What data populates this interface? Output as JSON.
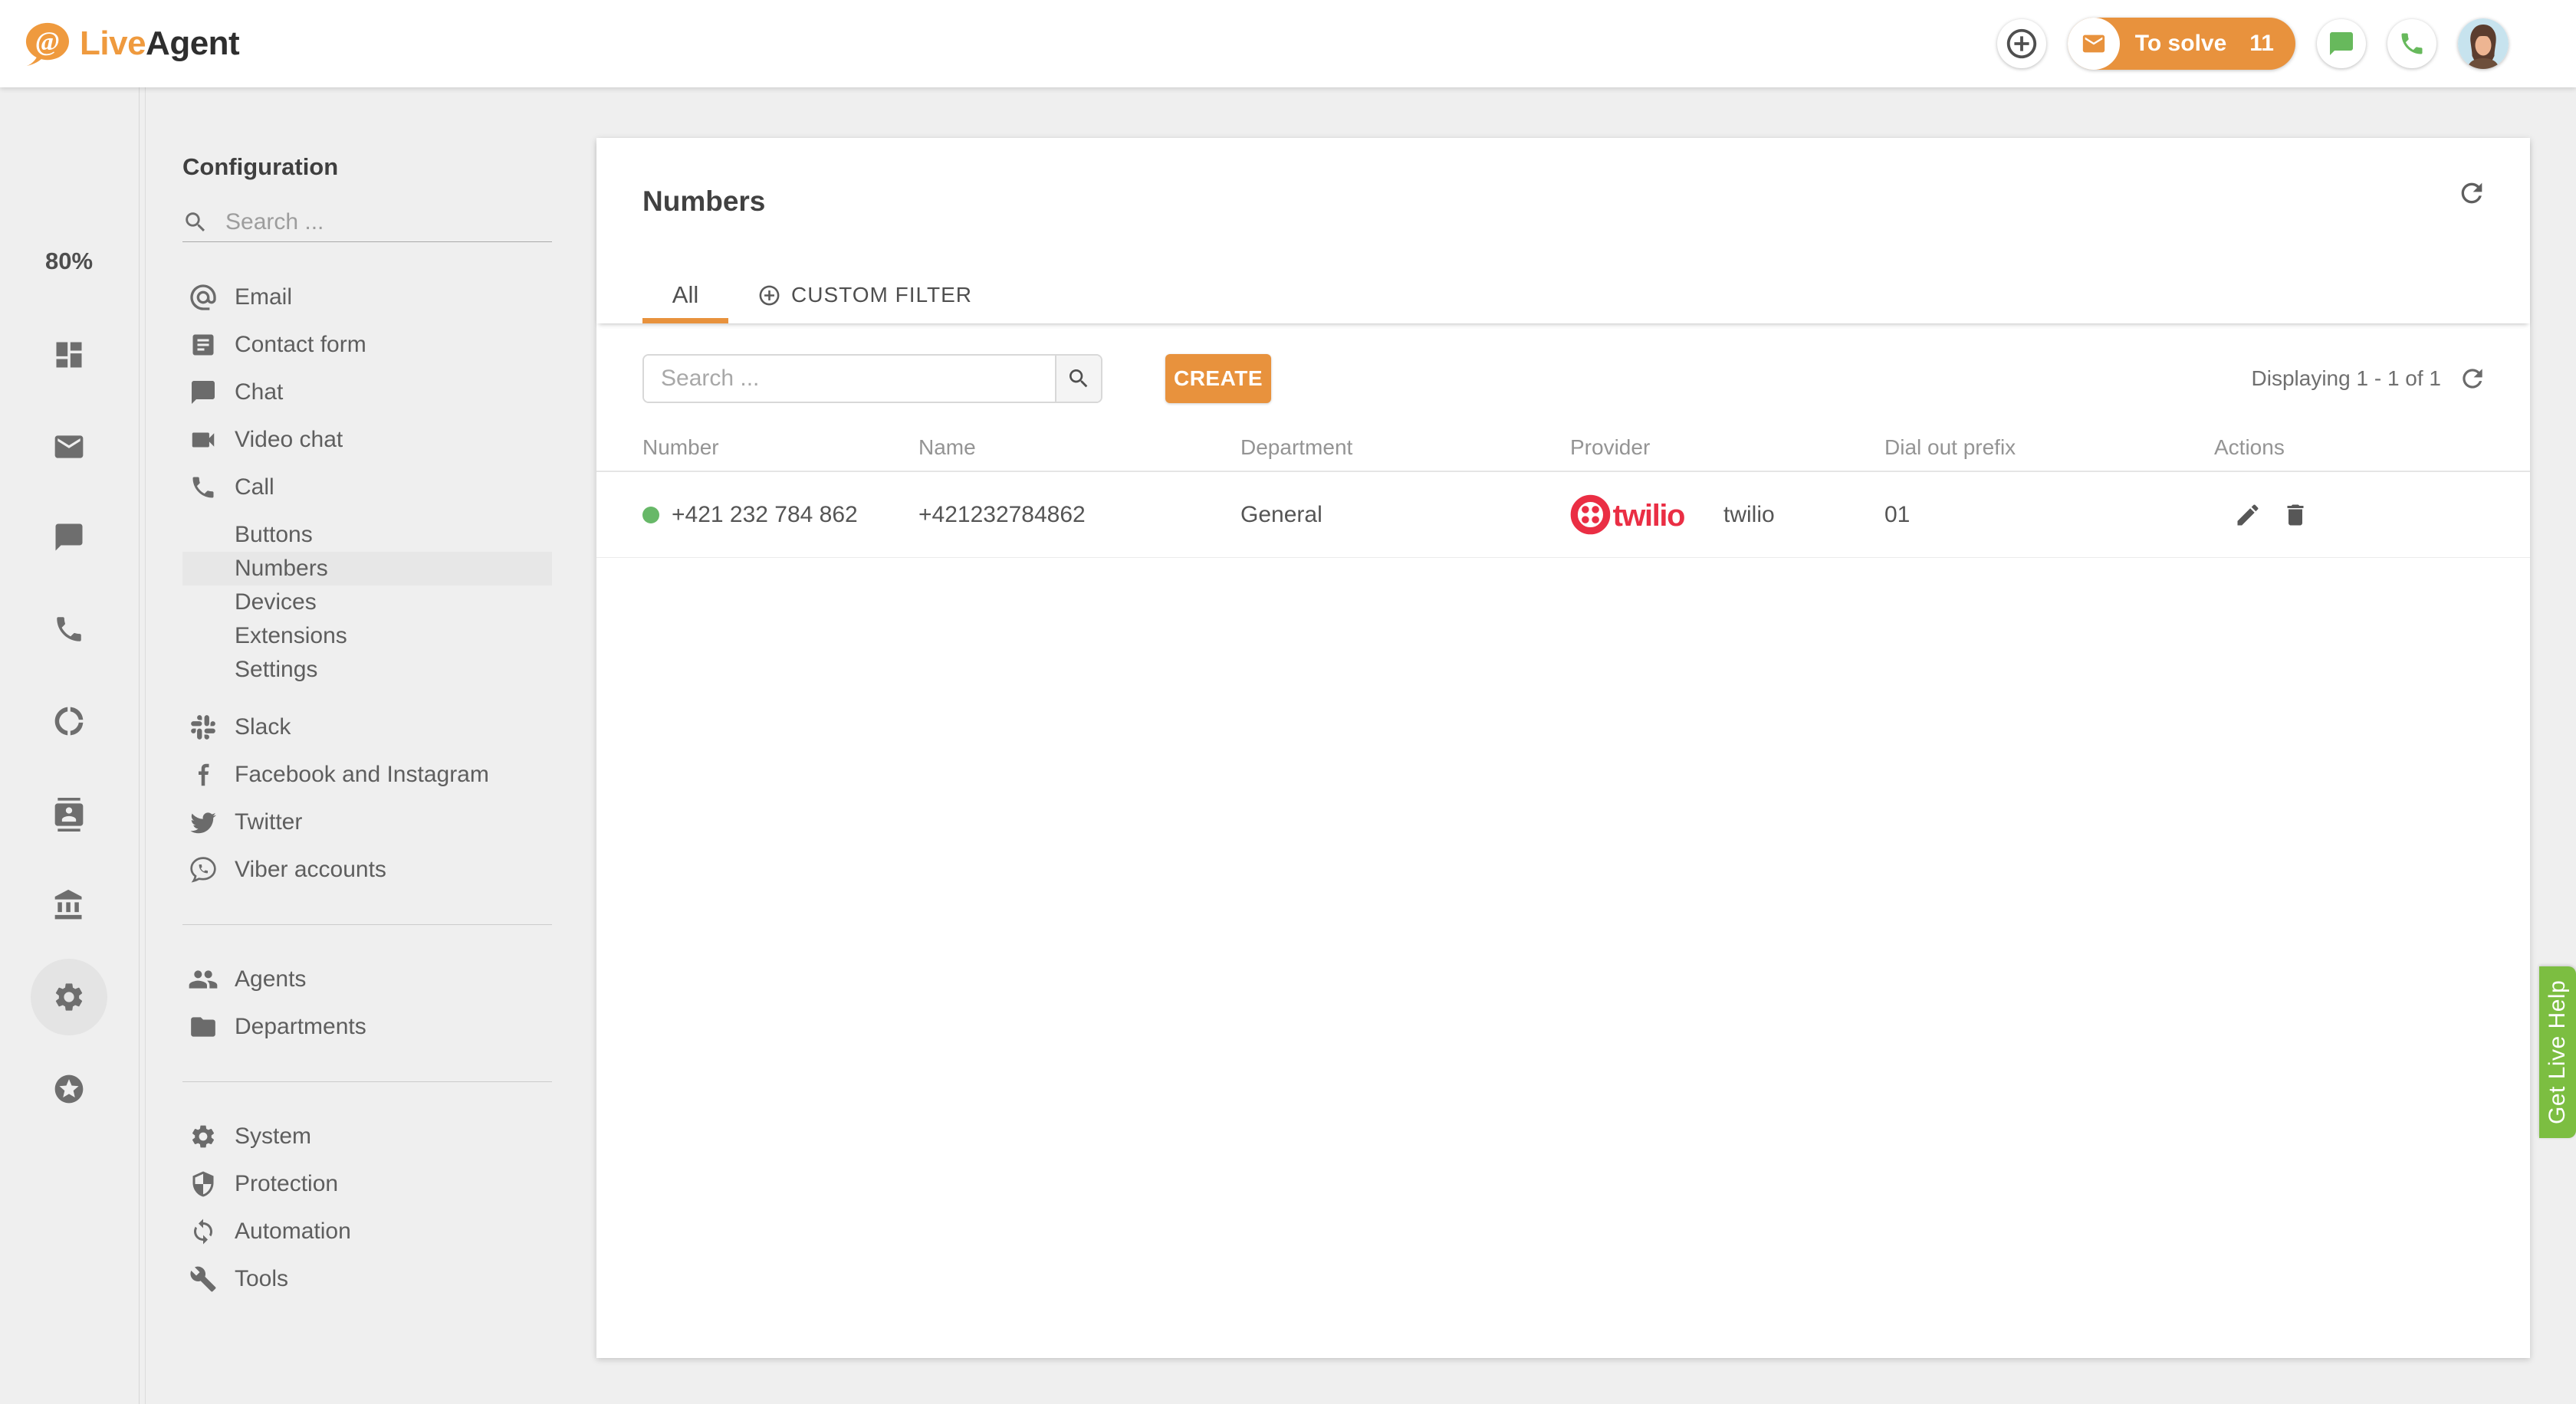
{
  "topbar": {
    "logo_live": "Live",
    "logo_agent": "Agent",
    "to_solve_label": "To solve",
    "to_solve_count": "11",
    "icons": [
      "add-circle-icon",
      "envelope-icon",
      "chat-bubble-icon",
      "phone-icon",
      "avatar"
    ]
  },
  "rail": {
    "usage_percent": "80%",
    "icons": [
      "dashboard-icon",
      "mail-icon",
      "chat-icon",
      "call-icon",
      "reports-donut-icon",
      "customers-card-icon",
      "billing-bank-icon",
      "settings-gear-icon",
      "upgrade-star-icon"
    ],
    "active_icon": "settings-gear-icon"
  },
  "sidebar": {
    "title": "Configuration",
    "search_placeholder": "Search ...",
    "active_item": "Numbers",
    "items": [
      {
        "label": "Email",
        "icon": "email-at-icon"
      },
      {
        "label": "Contact form",
        "icon": "contact-form-icon"
      },
      {
        "label": "Chat",
        "icon": "chat-icon"
      },
      {
        "label": "Video chat",
        "icon": "video-chat-icon"
      },
      {
        "label": "Call",
        "icon": "call-icon"
      },
      {
        "label": "Buttons",
        "icon": null
      },
      {
        "label": "Numbers",
        "icon": null
      },
      {
        "label": "Devices",
        "icon": null
      },
      {
        "label": "Extensions",
        "icon": null
      },
      {
        "label": "Settings",
        "icon": null
      },
      {
        "label": "Slack",
        "icon": "slack-icon"
      },
      {
        "label": "Facebook and Instagram",
        "icon": "facebook-icon"
      },
      {
        "label": "Twitter",
        "icon": "twitter-icon"
      },
      {
        "label": "Viber accounts",
        "icon": "viber-icon"
      },
      {
        "label": "Agents",
        "icon": "agents-icon"
      },
      {
        "label": "Departments",
        "icon": "departments-folder-icon"
      },
      {
        "label": "System",
        "icon": "system-gear-icon"
      },
      {
        "label": "Protection",
        "icon": "protection-shield-icon"
      },
      {
        "label": "Automation",
        "icon": "automation-sync-icon"
      },
      {
        "label": "Tools",
        "icon": "tools-wrench-icon"
      }
    ]
  },
  "main": {
    "title": "Numbers",
    "tabs": [
      {
        "label": "All",
        "active": true
      },
      {
        "label": "CUSTOM FILTER",
        "active": false,
        "icon": "add-circle-outline-icon"
      }
    ],
    "toolbar": {
      "search_placeholder": "Search ...",
      "create_label": "CREATE",
      "displaying": "Displaying 1 - 1 of 1"
    },
    "table": {
      "columns": [
        "Number",
        "Name",
        "Department",
        "Provider",
        "Dial out prefix",
        "Actions"
      ],
      "rows": [
        {
          "status": "online",
          "number": "+421 232 784 862",
          "name": "+421232784862",
          "department": "General",
          "provider_logo_text": "twilio",
          "provider_label": "twilio",
          "dial_out_prefix": "01",
          "actions": [
            "edit-icon",
            "delete-icon"
          ]
        }
      ]
    }
  },
  "help_tab": {
    "label": "Get Live Help"
  },
  "colors": {
    "brand_orange": "#e8923d",
    "logo_orange": "#ef9a3e",
    "topbar_green": "#67b95c",
    "help_green": "#7cbe41",
    "status_online_green": "#67b868",
    "twilio_red": "#ea2e44",
    "page_background": "#efefef",
    "active_row_highlight": "#e7e7e7"
  }
}
